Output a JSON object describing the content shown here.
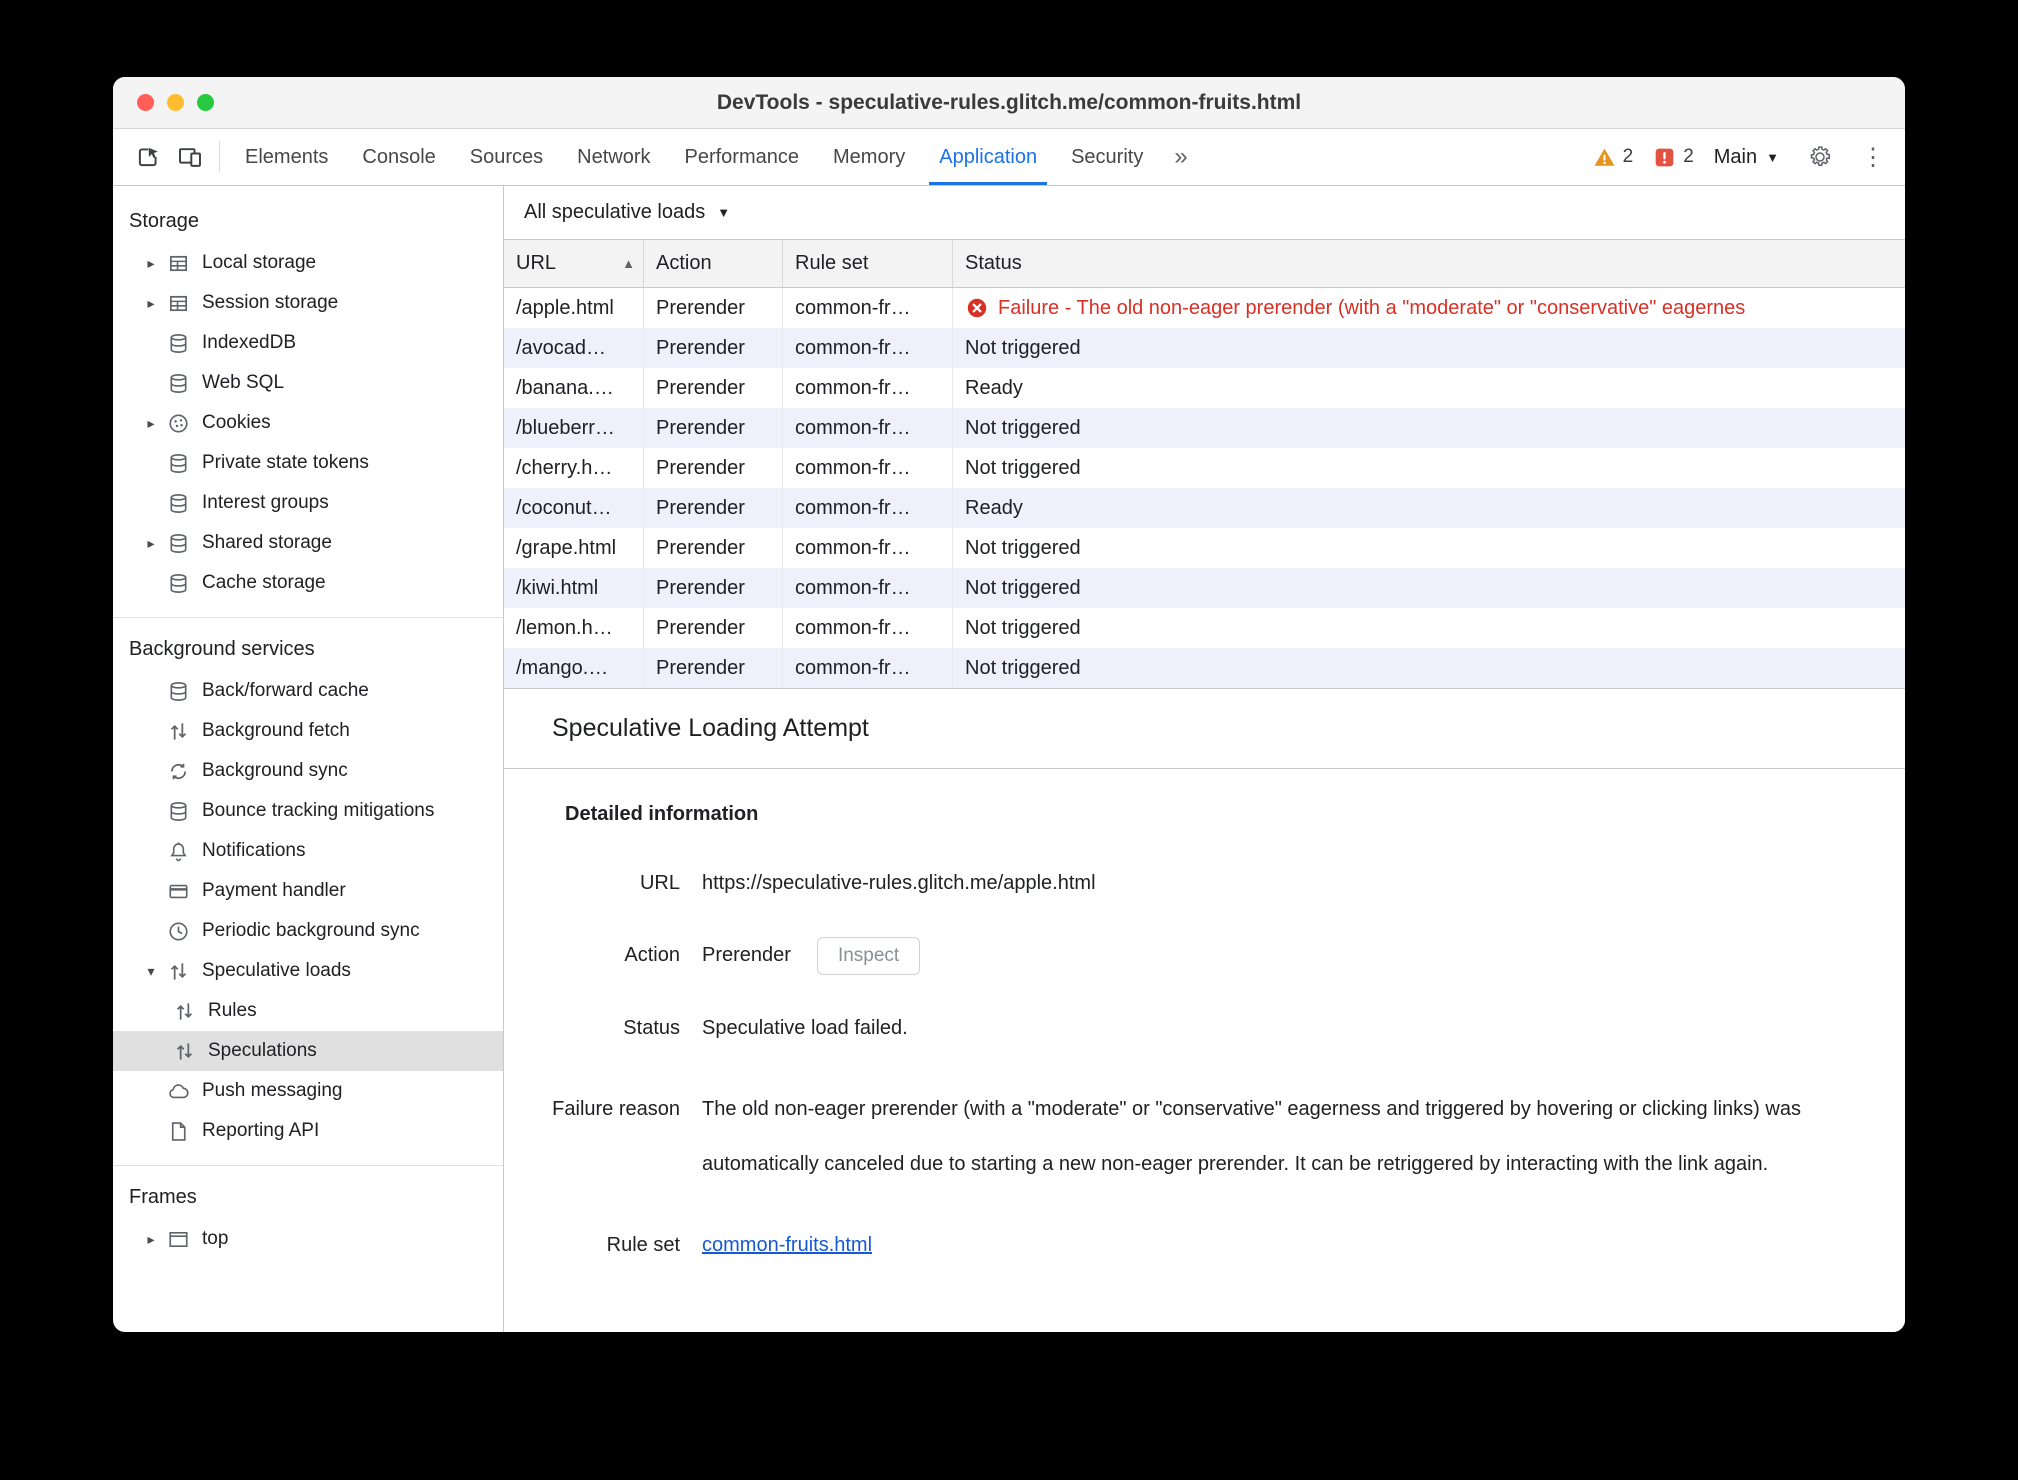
{
  "window": {
    "title": "DevTools - speculative-rules.glitch.me/common-fruits.html"
  },
  "toolbar": {
    "tabs": [
      "Elements",
      "Console",
      "Sources",
      "Network",
      "Performance",
      "Memory",
      "Application",
      "Security"
    ],
    "selected_tab": "Application",
    "warning_count": "2",
    "issue_count": "2",
    "main_label": "Main"
  },
  "sidebar": {
    "sections": [
      {
        "title": "Storage",
        "items": [
          {
            "label": "Local storage",
            "icon": "table-icon"
          },
          {
            "label": "Session storage",
            "icon": "table-icon"
          },
          {
            "label": "IndexedDB",
            "icon": "database-icon"
          },
          {
            "label": "Web SQL",
            "icon": "database-icon"
          },
          {
            "label": "Cookies",
            "icon": "cookie-icon"
          },
          {
            "label": "Private state tokens",
            "icon": "database-icon"
          },
          {
            "label": "Interest groups",
            "icon": "database-icon"
          },
          {
            "label": "Shared storage",
            "icon": "database-icon"
          },
          {
            "label": "Cache storage",
            "icon": "database-icon"
          }
        ]
      },
      {
        "title": "Background services",
        "items": [
          {
            "label": "Back/forward cache",
            "icon": "database-icon"
          },
          {
            "label": "Background fetch",
            "icon": "up-down-arrows-icon"
          },
          {
            "label": "Background sync",
            "icon": "sync-icon"
          },
          {
            "label": "Bounce tracking mitigations",
            "icon": "database-icon"
          },
          {
            "label": "Notifications",
            "icon": "bell-icon"
          },
          {
            "label": "Payment handler",
            "icon": "payment-card-icon"
          },
          {
            "label": "Periodic background sync",
            "icon": "clock-icon"
          },
          {
            "label": "Speculative loads",
            "icon": "up-down-arrows-icon"
          },
          {
            "label": "Rules",
            "icon": "up-down-arrows-icon"
          },
          {
            "label": "Speculations",
            "icon": "up-down-arrows-icon"
          },
          {
            "label": "Push messaging",
            "icon": "cloud-icon"
          },
          {
            "label": "Reporting API",
            "icon": "document-icon"
          }
        ]
      },
      {
        "title": "Frames",
        "items": [
          {
            "label": "top",
            "icon": "frame-icon"
          }
        ]
      }
    ]
  },
  "main": {
    "filter_label": "All speculative loads",
    "table": {
      "columns": [
        "URL",
        "Action",
        "Rule set",
        "Status"
      ],
      "rows": [
        {
          "url": "/apple.html",
          "action": "Prerender",
          "rule_set": "common-fr…",
          "status": "Failure - The old non-eager prerender (with a \"moderate\" or \"conservative\" eagernes"
        },
        {
          "url": "/avocad…",
          "action": "Prerender",
          "rule_set": "common-fr…",
          "status": "Not triggered"
        },
        {
          "url": "/banana.…",
          "action": "Prerender",
          "rule_set": "common-fr…",
          "status": "Ready"
        },
        {
          "url": "/blueberr…",
          "action": "Prerender",
          "rule_set": "common-fr…",
          "status": "Not triggered"
        },
        {
          "url": "/cherry.h…",
          "action": "Prerender",
          "rule_set": "common-fr…",
          "status": "Not triggered"
        },
        {
          "url": "/coconut…",
          "action": "Prerender",
          "rule_set": "common-fr…",
          "status": "Ready"
        },
        {
          "url": "/grape.html",
          "action": "Prerender",
          "rule_set": "common-fr…",
          "status": "Not triggered"
        },
        {
          "url": "/kiwi.html",
          "action": "Prerender",
          "rule_set": "common-fr…",
          "status": "Not triggered"
        },
        {
          "url": "/lemon.h…",
          "action": "Prerender",
          "rule_set": "common-fr…",
          "status": "Not triggered"
        },
        {
          "url": "/mango.…",
          "action": "Prerender",
          "rule_set": "common-fr…",
          "status": "Not triggered"
        }
      ]
    },
    "details": {
      "title": "Speculative Loading Attempt",
      "section_title": "Detailed information",
      "url_label": "URL",
      "url_value": "https://speculative-rules.glitch.me/apple.html",
      "action_label": "Action",
      "action_value": "Prerender",
      "inspect_button": "Inspect",
      "status_label": "Status",
      "status_value": "Speculative load failed.",
      "failure_label": "Failure reason",
      "failure_value": "The old non-eager prerender (with a \"moderate\" or \"conservative\" eagerness and triggered by hovering or clicking links) was automatically canceled due to starting a new non-eager prerender. It can be retriggered by interacting with the link again.",
      "rule_set_label": "Rule set",
      "rule_set_value": "common-fruits.html"
    }
  },
  "icons": {
    "disclosure_collapsed": "▸",
    "disclosure_expanded": "▾",
    "overflow_chevrons": "»",
    "kebab": "⋮",
    "dropdown_caret": "▼",
    "sort_ascending": "▲"
  },
  "colors": {
    "accent_blue": "#1a73e8",
    "failure_red": "#d93025",
    "link_blue": "#1558d6",
    "warning_orange": "#e8931c",
    "issue_red": "#e25141",
    "traffic_close": "#ff5f57",
    "traffic_minimize": "#febc2e",
    "traffic_zoom": "#28c840"
  }
}
